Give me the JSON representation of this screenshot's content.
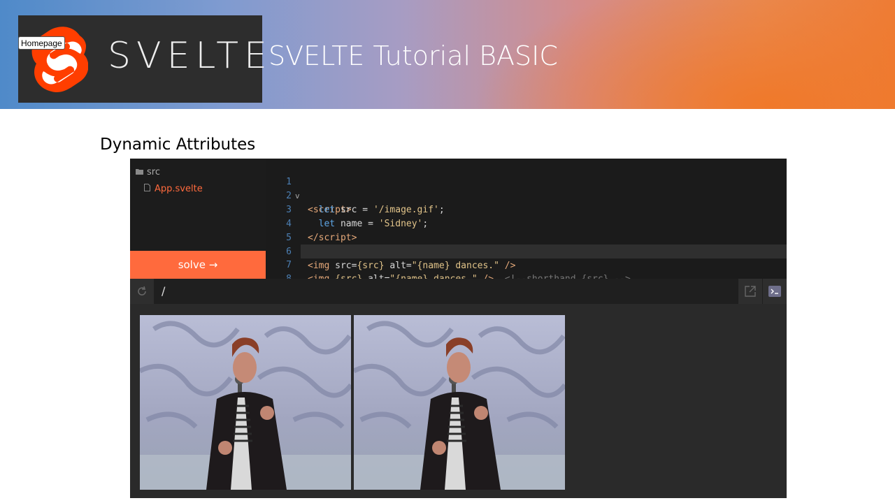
{
  "header": {
    "logo_word": "SVELTE",
    "homepage_button": "Homepage",
    "title": "SVELTE Tutorial BASIC"
  },
  "slide": {
    "subtitle": "Dynamic Attributes"
  },
  "repl": {
    "sidebar": {
      "folder_label": "src",
      "file_label": "App.svelte",
      "solve_label": "solve →"
    },
    "editor": {
      "line_numbers": [
        "1",
        "2",
        "3",
        "4",
        "5",
        "6",
        "7",
        "8"
      ]
    },
    "url": "/",
    "preview_images": [
      {
        "alt": "Sidney dances."
      },
      {
        "alt": "Sidney dances."
      }
    ]
  },
  "colors": {
    "accent": "#ff6a3d",
    "editor_bg": "#1b1b1b"
  }
}
